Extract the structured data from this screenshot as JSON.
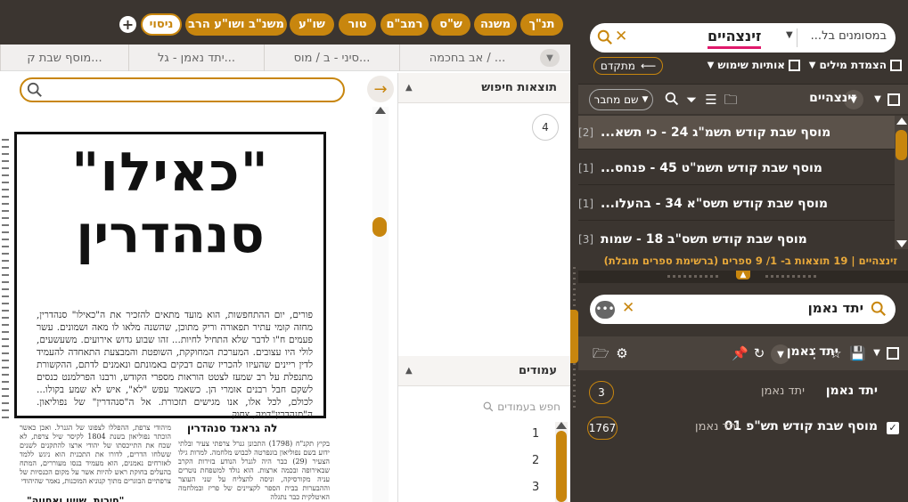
{
  "colors": {
    "accent": "#c8860e",
    "panel_bg": "#3b3530",
    "highlight": "#e0196b"
  },
  "categories": [
    {
      "label": "תנ\"ך"
    },
    {
      "label": "משנה"
    },
    {
      "label": "ש\"ס"
    },
    {
      "label": "רמב\"ם"
    },
    {
      "label": "טור"
    },
    {
      "label": "שו\"ע"
    },
    {
      "label": "משנ\"ב ושו\"ע הרב"
    },
    {
      "label": "ניסוי"
    }
  ],
  "tabs": [
    {
      "label": "אב בחכמה / ..."
    },
    {
      "label": "סיני - ב / מוס..."
    },
    {
      "label": "יתד נאמן - גל..."
    },
    {
      "label": "מוסף שבת ק..."
    }
  ],
  "document": {
    "headline_line1": "\"כאילו\"",
    "headline_line2": "סנהדרין",
    "article_text": "פורים, יום ההתחפשות, הוא מועד מתאים להזכיר את ה\"כאילו\" סנהדרין, מחזה קומי עתיר תפאורה וריק מתוכן, שהשנה מלאו לו מאה ושמונים. עשר פעמים ח\"ו לדבר שלא התחיל לחיות... זהו שבוע גדוש אירועים. משעשעים, לולי היו עצובים. המערכת המחוקקת, השופטת והמבצעת התאחדה להעמיד לדין ריינים שהעיזו להכריז שהם דבקים באמונתם ונאמנים לדתם, ההקשורת מתנפלת על רב שמעז לצטט הוראות מספרי הקודש, ורבנו הפרלמנט כנסים לשקם חבל רבנים אומרי הן. כשאמר עפש \"לא\", איש לא שמע בקולו... לכולם, לכל אלו, אנו מגישים תזכורת. אל ה\"סנהדרין\" של נפוליאון. ה\"סנהדרין\"דמה, צחוק.",
    "sub_heading": "לה גראנד סנהדרין",
    "sub_heading2": "\"חירות, שויון ואחווה\"",
    "col_left_text": "מיהודי צרפת, ההפללו לצפונו של הגנרל. ואכן כאשר הוכתר נפוליאון בשנת 1804 לקיסר שיל צרפת, לא שכח את התייכסתו של יהודי ארצו להתקנים לשנים ששלחו הדרים, לדורו את התכנית הוא ניגש ללמד לאזרחים נאמנים, הוא מעמיד בנסו מעוררים, המתח בהעלים בחוקת ראש להיות אשר על מקום הכנסיות של צרפתיים הבוגרים מתוך קנוניא המוכנות, נאמר שהיהודי",
    "col_right_text": "בקיץ תקנ\"ח (1798) התכונן גנרל צרפתי צעיר ובלתי ידוע בשם נפוליאון בונפרטה לכבוש מלחמה. למרות גילו הצעיר (29) כבר היה לגנרל הנודע בזירות הקרב שבאירופה ובכמה ארצות. הוא נולד למשפחת נוטרים עניה מקורסיקה, וניסה להצליח על שני העוצר וההבערות בבית הספר לקציינים של פריז ובמלחמה האיטלקית כבר נתגלה"
  },
  "search_results_pane": {
    "title": "תוצאות חיפוש",
    "count": "4"
  },
  "pages_pane": {
    "title": "עמודים",
    "search_placeholder": "חפש בעמודים",
    "pages": [
      "1",
      "2",
      "3"
    ]
  },
  "search": {
    "scope_label": "במסומנים בל...",
    "term": "זינצהיים",
    "options": {
      "word_adjacency": {
        "label": "הצמדת מילים",
        "checked": false
      },
      "functional_letters": {
        "label": "אותיות שימוש",
        "checked": false
      },
      "advanced": {
        "label": "מתקדם"
      }
    }
  },
  "results_toolbar": {
    "title": "זינצהיים",
    "author_label": "שם מחבר"
  },
  "results": [
    {
      "title": "מוסף שבת קודש תשמ\"ג 24 - כי תשא...",
      "count": "[2]"
    },
    {
      "title": "מוסף שבת קודש תשמ\"ט 45 - פנחס...",
      "count": "[1]"
    },
    {
      "title": "מוסף שבת קודש תשס\"א 34 - בהעלו...",
      "count": "[1]"
    },
    {
      "title": "מוסף שבת קודש תשס\"ב 18 - שמות",
      "count": "[3]"
    }
  ],
  "summary": "זינצהיים | 19 תוצאות ב- 1/ 9 ספרים (ברשימת ספרים מובלת)",
  "books_search": {
    "term": "יתד נאמן"
  },
  "books_toolbar": {
    "title": "יתד נאמן"
  },
  "books_tree": [
    {
      "name": "יתד נאמן",
      "path": "יתד נאמן",
      "count": "3",
      "checked": false
    },
    {
      "name": "מוסף שבת קודש תש\"פ 01",
      "path": "יתד נאמן",
      "count": "1767",
      "checked": true
    }
  ]
}
